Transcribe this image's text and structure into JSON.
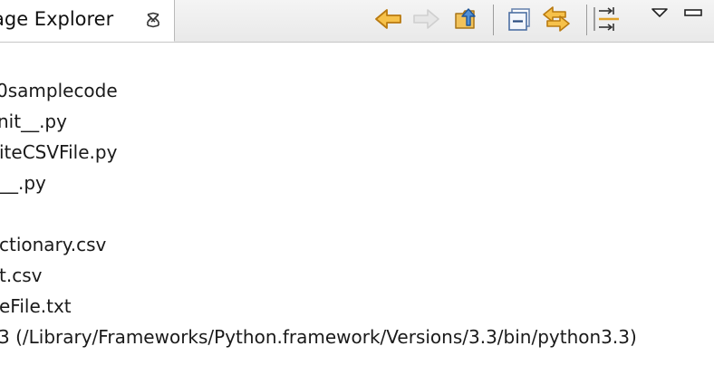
{
  "view": {
    "title": "age Explorer",
    "tab_close_icon": "close-tab-icon"
  },
  "toolbar": {
    "buttons": [
      {
        "name": "back-button",
        "icon": "arrow-left-icon",
        "enabled": true
      },
      {
        "name": "forward-button",
        "icon": "arrow-right-icon",
        "enabled": false
      },
      {
        "name": "up-button",
        "icon": "folder-up-icon",
        "enabled": true
      },
      {
        "name": "collapse-all-button",
        "icon": "collapse-all-icon",
        "enabled": true
      },
      {
        "name": "link-with-editor-button",
        "icon": "link-editor-icon",
        "enabled": true
      },
      {
        "name": "filters-button",
        "icon": "filters-icon",
        "enabled": true
      },
      {
        "name": "view-menu-button",
        "icon": "triangle-down-icon",
        "enabled": true
      },
      {
        "name": "minimize-button",
        "icon": "minimize-icon",
        "enabled": true
      }
    ],
    "accent_color": "#e8a72c",
    "accent_dark": "#b97a10"
  },
  "tree": {
    "items": [
      "0samplecode",
      "nit__.py",
      "iteCSVFile.py",
      "__.py",
      "",
      "ctionary.csv",
      "t.csv",
      "eFile.txt",
      "3  (/Library/Frameworks/Python.framework/Versions/3.3/bin/python3.3)"
    ]
  }
}
